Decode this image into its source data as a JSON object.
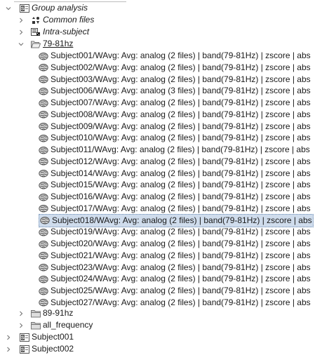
{
  "tree": {
    "group": {
      "label": "Group analysis",
      "icon": "study-icon"
    },
    "common_files": {
      "label": "Common files",
      "icon": "common-files-icon"
    },
    "intra_subject": {
      "label": "Intra-subject",
      "icon": "intra-subject-icon"
    },
    "folder_79_81": {
      "label": "79-81hz",
      "icon": "folder-open-icon"
    },
    "entries": [
      "Subject001/WAvg: Avg: analog (2 files) | band(79-81Hz) | zscore | abs",
      "Subject002/WAvg: Avg: analog (2 files) | band(79-81Hz) | zscore | abs",
      "Subject003/WAvg: Avg: analog (2 files) | band(79-81Hz) | zscore | abs",
      "Subject006/WAvg: Avg: analog (3 files) | band(79-81Hz) | zscore | abs",
      "Subject007/WAvg: Avg: analog (2 files) | band(79-81Hz) | zscore | abs",
      "Subject008/WAvg: Avg: analog (2 files) | band(79-81Hz) | zscore | abs",
      "Subject009/WAvg: Avg: analog (2 files) | band(79-81Hz) | zscore | abs",
      "Subject010/WAvg: Avg: analog (2 files) | band(79-81Hz) | zscore | abs",
      "Subject011/WAvg: Avg: analog (2 files) | band(79-81Hz) | zscore | abs",
      "Subject012/WAvg: Avg: analog (2 files) | band(79-81Hz) | zscore | abs",
      "Subject014/WAvg: Avg: analog (2 files) | band(79-81Hz) | zscore | abs",
      "Subject015/WAvg: Avg: analog (2 files) | band(79-81Hz) | zscore | abs",
      "Subject016/WAvg: Avg: analog (2 files) | band(79-81Hz) | zscore | abs",
      "Subject017/WAvg: Avg: analog (2 files) | band(79-81Hz) | zscore | abs",
      "Subject018/WAvg: Avg: analog (2 files) | band(79-81Hz) | zscore | abs",
      "Subject019/WAvg: Avg: analog (2 files) | band(79-81Hz) | zscore | abs",
      "Subject020/WAvg: Avg: analog (2 files) | band(79-81Hz) | zscore | abs",
      "Subject021/WAvg: Avg: analog (2 files) | band(79-81Hz) | zscore | abs",
      "Subject023/WAvg: Avg: analog (2 files) | band(79-81Hz) | zscore | abs",
      "Subject024/WAvg: Avg: analog (2 files) | band(79-81Hz) | zscore | abs",
      "Subject025/WAvg: Avg: analog (2 files) | band(79-81Hz) | zscore | abs",
      "Subject027/WAvg: Avg: analog (2 files) | band(79-81Hz) | zscore | abs"
    ],
    "selected_entry": "Subject018/WAvg: Avg: analog (2 files) | band(79-81Hz) | zscore | abs",
    "entry_icon": "brain-surface-icon",
    "folder_89_91": {
      "label": "89-91hz",
      "icon": "folder-icon"
    },
    "folder_all": {
      "label": "all_frequency",
      "icon": "folder-icon"
    },
    "subjects": [
      {
        "label": "Subject001",
        "icon": "subject-icon"
      },
      {
        "label": "Subject002",
        "icon": "subject-icon"
      }
    ]
  },
  "colors": {
    "selection_bg": "#cfdcec",
    "selection_border": "#6d8db4",
    "chevron": "#7a7a7a",
    "folder": "#9a9a9a"
  }
}
